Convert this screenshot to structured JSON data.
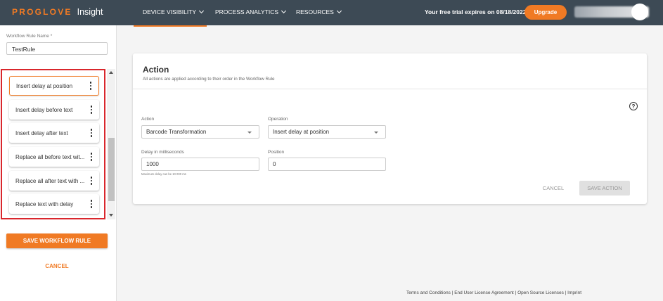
{
  "header": {
    "brand": "PROGLOVE",
    "product": "Insight",
    "nav": [
      {
        "label": "DEVICE VISIBILITY"
      },
      {
        "label": "PROCESS ANALYTICS"
      },
      {
        "label": "RESOURCES"
      }
    ],
    "trial_text": "Your free trial expires on 08/18/2022",
    "upgrade_label": "Upgrade"
  },
  "left_panel": {
    "rule_name_label": "Workflow Rule Name *",
    "rule_name_value": "TestRule",
    "actions": [
      {
        "label": "Insert delay at position"
      },
      {
        "label": "Insert delay before text"
      },
      {
        "label": "Insert delay after text"
      },
      {
        "label": "Replace all before text wit..."
      },
      {
        "label": "Replace all after text with ..."
      },
      {
        "label": "Replace text with delay"
      }
    ],
    "save_label": "SAVE WORKFLOW RULE",
    "cancel_label": "CANCEL"
  },
  "action_card": {
    "title": "Action",
    "subtitle": "All actions are applied according to their order in the Workflow Rule",
    "help_symbol": "?",
    "action_label": "Action",
    "action_value": "Barcode Transformation",
    "operation_label": "Operation",
    "operation_value": "Insert delay at position",
    "delay_label": "Delay in milliseconds",
    "delay_value": "1000",
    "delay_hint": "Maximum delay can be 10 000 ms",
    "position_label": "Position",
    "position_value": "0",
    "cancel_label": "CANCEL",
    "save_label": "SAVE ACTION"
  },
  "footer": {
    "links": [
      "Terms and Conditions",
      "End User License Agreement",
      "Open Source Licenses",
      "Imprint"
    ],
    "separator": " | "
  },
  "colors": {
    "accent": "#f07a24",
    "topbar": "#3d4a55",
    "highlight_border": "#d9262c"
  }
}
